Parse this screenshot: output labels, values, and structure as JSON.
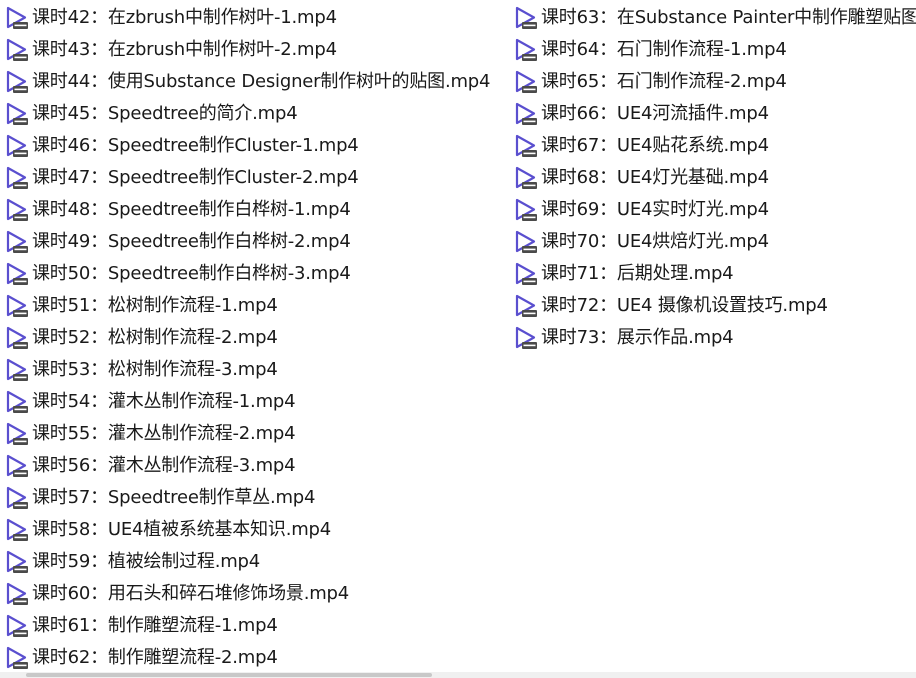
{
  "icon": "video-file-icon",
  "colors": {
    "icon_accent": "#5a4fcf",
    "icon_badge": "#4a4a4a"
  },
  "files": {
    "left": [
      "课时42：在zbrush中制作树叶-1.mp4",
      "课时43：在zbrush中制作树叶-2.mp4",
      "课时44：使用Substance Designer制作树叶的贴图.mp4",
      "课时45：Speedtree的简介.mp4",
      "课时46：Speedtree制作Cluster-1.mp4",
      "课时47：Speedtree制作Cluster-2.mp4",
      "课时48：Speedtree制作白桦树-1.mp4",
      "课时49：Speedtree制作白桦树-2.mp4",
      "课时50：Speedtree制作白桦树-3.mp4",
      "课时51：松树制作流程-1.mp4",
      "课时52：松树制作流程-2.mp4",
      "课时53：松树制作流程-3.mp4",
      "课时54：灌木丛制作流程-1.mp4",
      "课时55：灌木丛制作流程-2.mp4",
      "课时56：灌木丛制作流程-3.mp4",
      "课时57：Speedtree制作草丛.mp4",
      "课时58：UE4植被系统基本知识.mp4",
      "课时59：植被绘制过程.mp4",
      "课时60：用石头和碎石堆修饰场景.mp4",
      "课时61：制作雕塑流程-1.mp4",
      "课时62：制作雕塑流程-2.mp4"
    ],
    "right": [
      "课时63：在Substance Painter中制作雕塑贴图",
      "课时64：石门制作流程-1.mp4",
      "课时65：石门制作流程-2.mp4",
      "课时66：UE4河流插件.mp4",
      "课时67：UE4贴花系统.mp4",
      "课时68：UE4灯光基础.mp4",
      "课时69：UE4实时灯光.mp4",
      "课时70：UE4烘焙灯光.mp4",
      "课时71：后期处理.mp4",
      "课时72：UE4 摄像机设置技巧.mp4",
      "课时73：展示作品.mp4"
    ]
  }
}
